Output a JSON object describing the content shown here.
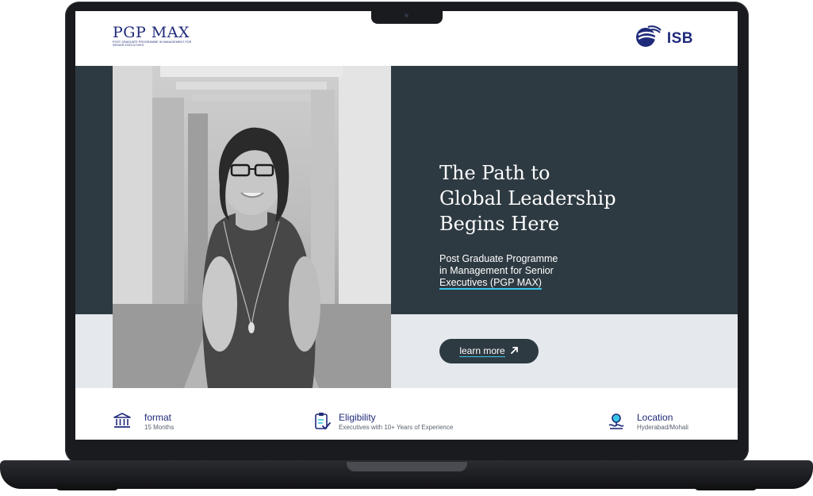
{
  "brand": {
    "program_logo_main": "PGP MAX",
    "program_logo_sub": "Post Graduate Programme in Management for Senior Executives",
    "institution_logo": "ISB"
  },
  "hero": {
    "title_lines": [
      "The Path to",
      "Global Leadership",
      "Begins Here"
    ],
    "subtitle_line1": "Post Graduate Programme",
    "subtitle_line2": "in Management for Senior",
    "subtitle_line3": "Executives (PGP MAX)",
    "cta_label": "learn more",
    "cta_icon": "arrow-up-right-icon"
  },
  "info_items": [
    {
      "icon": "institution-icon",
      "title": "format",
      "value": "15 Months"
    },
    {
      "icon": "clipboard-check-icon",
      "title": "Eligibility",
      "value": "Executives with 10+ Years of Experience"
    },
    {
      "icon": "location-pin-icon",
      "title": "Location",
      "value": "Hyderabad/Mohali"
    }
  ],
  "colors": {
    "brand_navy": "#1f2a7a",
    "hero_dark": "#2e3a42",
    "hero_light": "#e5e9ed",
    "accent_cyan": "#38c6e8"
  }
}
